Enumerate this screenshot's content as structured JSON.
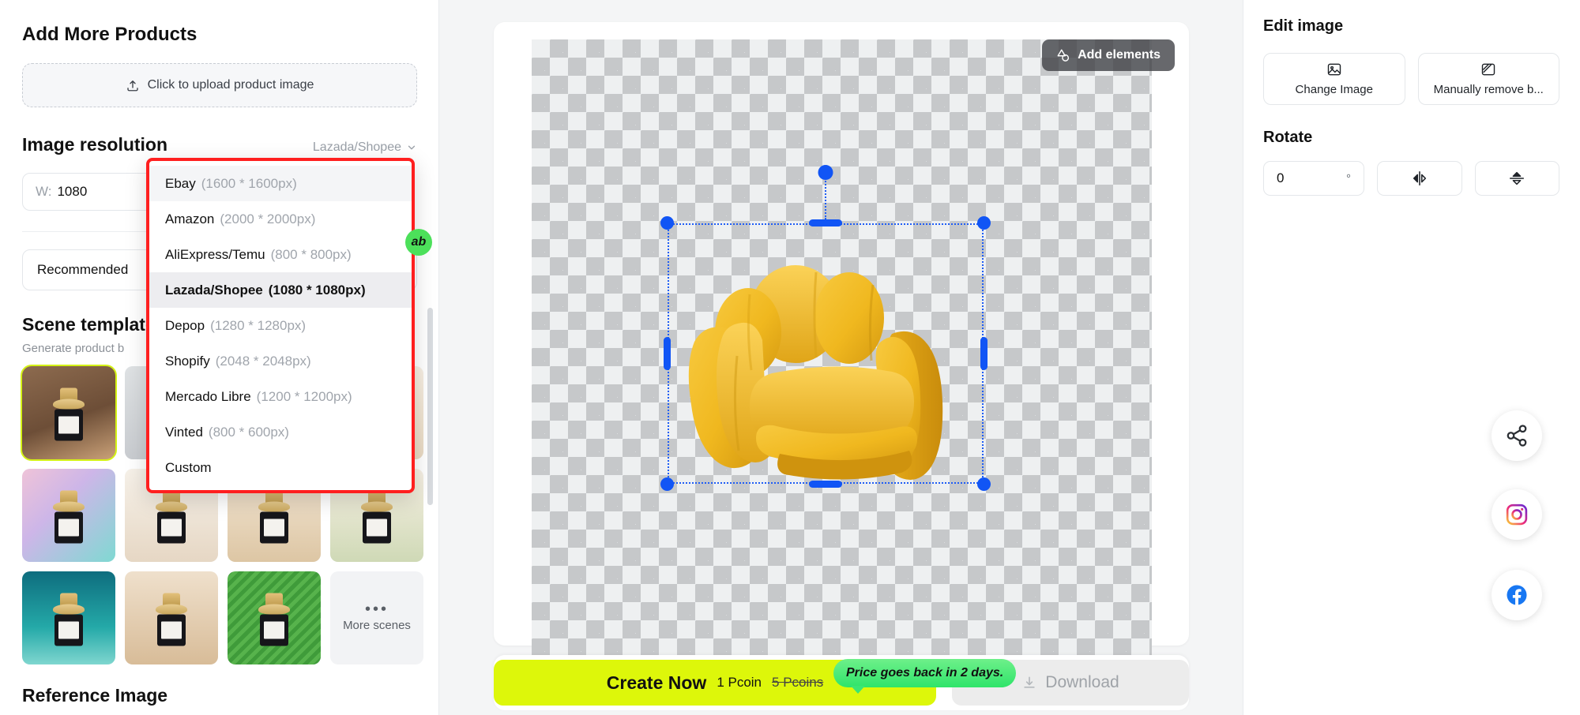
{
  "left_panel": {
    "title": "Add More Products",
    "upload": {
      "label": "Click to upload product image",
      "icon": "upload-icon"
    },
    "image_resolution": {
      "heading": "Image resolution",
      "selected_preset": "Lazada/Shopee",
      "chevron_icon": "chevron-down-icon",
      "width_label": "W:",
      "width_value": "1080"
    },
    "recommended_box_label": "Recommended",
    "scene_template": {
      "heading": "Scene template",
      "subtitle": "Generate product b",
      "more_label": "More scenes",
      "more_dots": "•••"
    },
    "reference_image_heading": "Reference Image"
  },
  "resolution_dropdown": {
    "highlight_color": "#ff1f1f",
    "items": [
      {
        "name": "Ebay",
        "size": "(1600 * 1600px)",
        "state": "hovered"
      },
      {
        "name": "Amazon",
        "size": "(2000 * 2000px)",
        "state": "normal"
      },
      {
        "name": "AliExpress/Temu",
        "size": "(800 * 800px)",
        "state": "normal"
      },
      {
        "name": "Lazada/Shopee",
        "size": "(1080 * 1080px)",
        "state": "active"
      },
      {
        "name": "Depop",
        "size": "(1280 * 1280px)",
        "state": "normal"
      },
      {
        "name": "Shopify",
        "size": "(2048 * 2048px)",
        "state": "normal"
      },
      {
        "name": "Mercado Libre",
        "size": "(1200 * 1200px)",
        "state": "normal"
      },
      {
        "name": "Vinted",
        "size": "(800 * 600px)",
        "state": "normal"
      },
      {
        "name": "Custom",
        "size": "",
        "state": "normal"
      }
    ]
  },
  "canvas": {
    "add_elements_label": "Add elements",
    "add_elements_icon": "shapes-icon",
    "product_name": "yellow-armchair",
    "badge_label": "ab"
  },
  "bottom_bar": {
    "create_label": "Create Now",
    "price_current": "1 Pcoin",
    "price_old": "5 Pcoins",
    "tooltip": "Price goes back in 2 days.",
    "download_label": "Download",
    "download_icon": "download-icon",
    "accent_color": "#ddf70a",
    "tooltip_color": "#3ae674"
  },
  "right_panel": {
    "title": "Edit image",
    "change_image_label": "Change Image",
    "change_image_icon": "image-icon",
    "manual_remove_label": "Manually remove b...",
    "manual_remove_icon": "eraser-icon",
    "rotate_heading": "Rotate",
    "rotate_value": "0",
    "rotate_unit": "°",
    "flip_horizontal_icon": "flip-horizontal-icon",
    "flip_vertical_icon": "flip-vertical-icon",
    "social": [
      {
        "name": "share-icon",
        "label": "Share"
      },
      {
        "name": "instagram-icon",
        "label": "Instagram"
      },
      {
        "name": "facebook-icon",
        "label": "Facebook"
      }
    ]
  }
}
